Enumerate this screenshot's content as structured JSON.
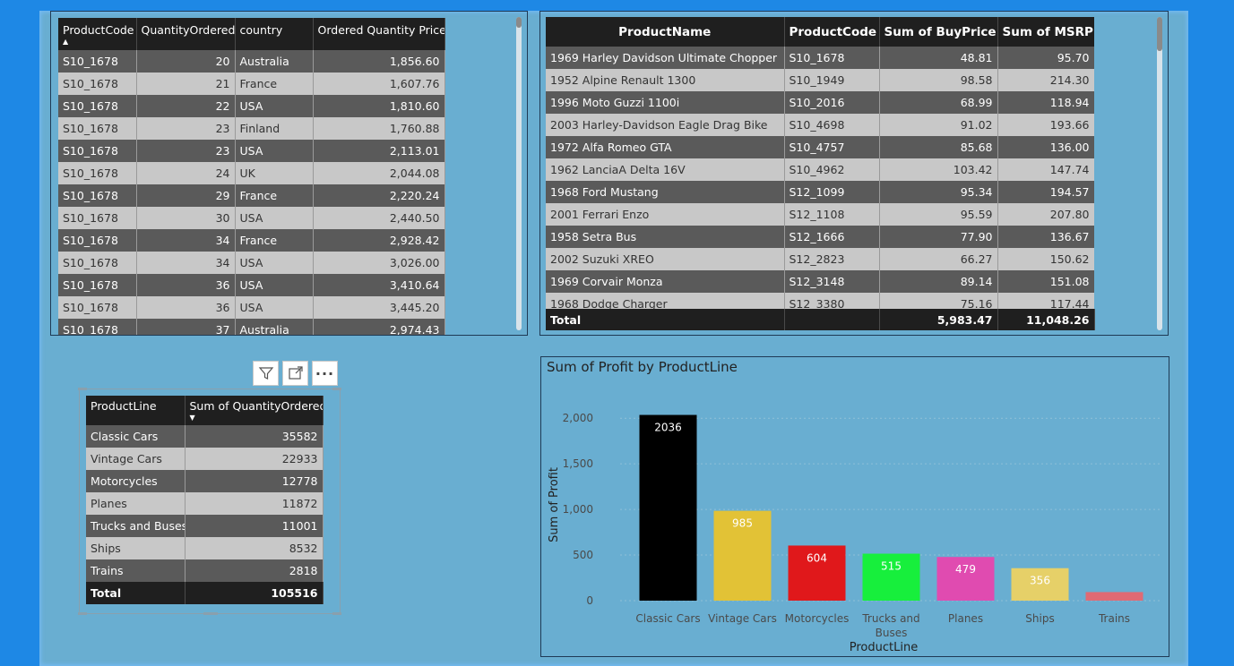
{
  "table_orders": {
    "headers": [
      "ProductCode",
      "QuantityOrdered",
      "country",
      "Ordered Quantity Price"
    ],
    "sort_column": "ProductCode",
    "rows": [
      [
        "S10_1678",
        "20",
        "Australia",
        "1,856.60"
      ],
      [
        "S10_1678",
        "21",
        "France",
        "1,607.76"
      ],
      [
        "S10_1678",
        "22",
        "USA",
        "1,810.60"
      ],
      [
        "S10_1678",
        "23",
        "Finland",
        "1,760.88"
      ],
      [
        "S10_1678",
        "23",
        "USA",
        "2,113.01"
      ],
      [
        "S10_1678",
        "24",
        "UK",
        "2,044.08"
      ],
      [
        "S10_1678",
        "29",
        "France",
        "2,220.24"
      ],
      [
        "S10_1678",
        "30",
        "USA",
        "2,440.50"
      ],
      [
        "S10_1678",
        "34",
        "France",
        "2,928.42"
      ],
      [
        "S10_1678",
        "34",
        "USA",
        "3,026.00"
      ],
      [
        "S10_1678",
        "36",
        "USA",
        "3,410.64"
      ],
      [
        "S10_1678",
        "36",
        "USA",
        "3,445.20"
      ],
      [
        "S10_1678",
        "37",
        "Australia",
        "2,974.43"
      ]
    ]
  },
  "table_products": {
    "headers": [
      "ProductName",
      "ProductCode",
      "Sum of BuyPrice",
      "Sum of MSRP"
    ],
    "rows": [
      [
        "1969 Harley Davidson Ultimate Chopper",
        "S10_1678",
        "48.81",
        "95.70"
      ],
      [
        "1952 Alpine Renault 1300",
        "S10_1949",
        "98.58",
        "214.30"
      ],
      [
        "1996 Moto Guzzi 1100i",
        "S10_2016",
        "68.99",
        "118.94"
      ],
      [
        "2003 Harley-Davidson Eagle Drag Bike",
        "S10_4698",
        "91.02",
        "193.66"
      ],
      [
        "1972 Alfa Romeo GTA",
        "S10_4757",
        "85.68",
        "136.00"
      ],
      [
        "1962 LanciaA Delta 16V",
        "S10_4962",
        "103.42",
        "147.74"
      ],
      [
        "1968 Ford Mustang",
        "S12_1099",
        "95.34",
        "194.57"
      ],
      [
        "2001 Ferrari Enzo",
        "S12_1108",
        "95.59",
        "207.80"
      ],
      [
        "1958 Setra Bus",
        "S12_1666",
        "77.90",
        "136.67"
      ],
      [
        "2002 Suzuki XREO",
        "S12_2823",
        "66.27",
        "150.62"
      ],
      [
        "1969 Corvair Monza",
        "S12_3148",
        "89.14",
        "151.08"
      ],
      [
        "1968 Dodge Charger",
        "S12_3380",
        "75.16",
        "117.44"
      ]
    ],
    "total": {
      "label": "Total",
      "buy_price": "5,983.47",
      "msrp": "11,048.26"
    }
  },
  "table_productline": {
    "headers": [
      "ProductLine",
      "Sum of QuantityOrdered"
    ],
    "sort_column": "Sum of QuantityOrdered",
    "rows": [
      [
        "Classic Cars",
        "35582"
      ],
      [
        "Vintage Cars",
        "22933"
      ],
      [
        "Motorcycles",
        "12778"
      ],
      [
        "Planes",
        "11872"
      ],
      [
        "Trucks and Buses",
        "11001"
      ],
      [
        "Ships",
        "8532"
      ],
      [
        "Trains",
        "2818"
      ]
    ],
    "total": {
      "label": "Total",
      "value": "105516"
    }
  },
  "visual_header": {
    "icons": [
      "filter-icon",
      "focus-mode-icon",
      "more-options-icon"
    ],
    "more_label": "···"
  },
  "chart_data": {
    "type": "bar",
    "title": "Sum of Profit by ProductLine",
    "xlabel": "ProductLine",
    "ylabel": "Sum of Profit",
    "categories": [
      "Classic Cars",
      "Vintage Cars",
      "Motorcycles",
      "Trucks and Buses",
      "Planes",
      "Ships",
      "Trains"
    ],
    "values": [
      2036,
      985,
      604,
      515,
      479,
      356,
      94
    ],
    "data_labels": [
      "2036",
      "985",
      "604",
      "515",
      "479",
      "356",
      ""
    ],
    "colors": [
      "#000000",
      "#e2c236",
      "#e0181b",
      "#17ef3c",
      "#e04bb0",
      "#e6d068",
      "#e06a74"
    ],
    "yticks": [
      "0",
      "500",
      "1,000",
      "1,500",
      "2,000"
    ],
    "ylim": [
      0,
      2100
    ],
    "grid": true
  }
}
